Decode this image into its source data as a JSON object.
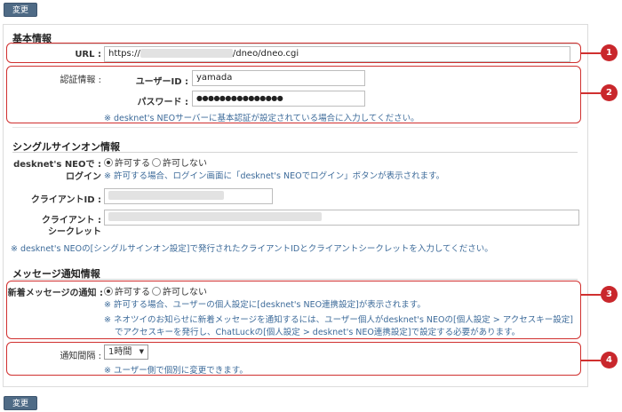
{
  "buttons": {
    "change_top": "変更",
    "change_bottom": "変更"
  },
  "basic": {
    "title": "基本情報",
    "url_label": "URL :",
    "url_prefix": "https://",
    "url_suffix": "/dneo/dneo.cgi",
    "auth_label": "認証情報 :",
    "userid_label": "ユーザーID :",
    "userid_value": "yamada",
    "password_label": "パスワード :",
    "password_value": "●●●●●●●●●●●●●●●",
    "auth_note": "※ desknet's NEOサーバーに基本認証が設定されている場合に入力してください。"
  },
  "sso": {
    "title": "シングルサインオン情報",
    "login_label_1": "desknet's NEOで :",
    "login_label_2": "ログイン",
    "allow": "許可する",
    "deny": "許可しない",
    "login_note": "※ 許可する場合、ログイン画面に「desknet's NEOでログイン」ボタンが表示されます。",
    "client_id_label": "クライアントID :",
    "client_secret_label_1": "クライアント :",
    "client_secret_label_2": "シークレット",
    "footer_note": "※ desknet's NEOの[シングルサインオン設定]で発行されたクライアントIDとクライアントシークレットを入力してください。"
  },
  "notify": {
    "title": "メッセージ通知情報",
    "new_label": "新着メッセージの通知 :",
    "allow": "許可する",
    "deny": "許可しない",
    "note1": "※ 許可する場合、ユーザーの個人設定に[desknet's NEO連携設定]が表示されます。",
    "note2": "※ ネオツイのお知らせに新着メッセージを通知するには、ユーザー個人がdesknet's NEOの[個人設定 > アクセスキー設定]",
    "note3": "でアクセスキーを発行し、ChatLuckの[個人設定 > desknet's NEO連携設定]で設定する必要があります。",
    "interval_label": "通知間隔 :",
    "interval_value": "1時間",
    "interval_note": "※ ユーザー側で個別に変更できます。"
  },
  "callouts": [
    "1",
    "2",
    "3",
    "4"
  ],
  "colors": {
    "callout": "#d0302f",
    "note": "#3d6b9a",
    "button": "#4f6b86"
  }
}
